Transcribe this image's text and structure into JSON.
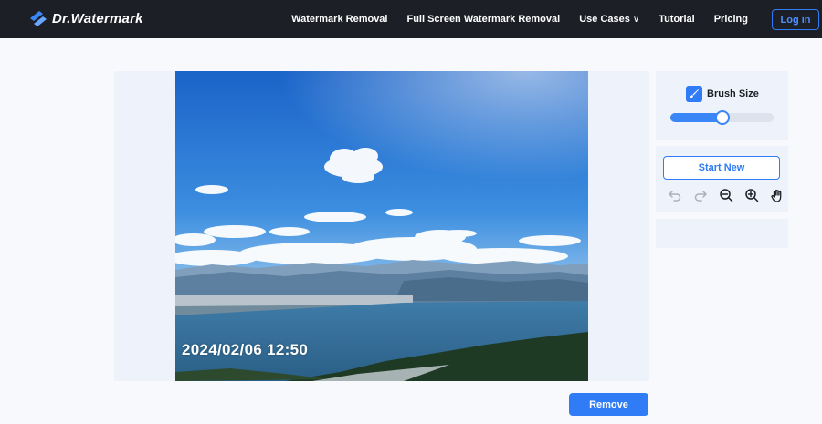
{
  "nav": {
    "brand": "Dr.Watermark",
    "links": [
      "Watermark Removal",
      "Full Screen Watermark Removal",
      "Use Cases",
      "Tutorial",
      "Pricing"
    ],
    "use_cases_caret": "∨",
    "login_label": "Log in"
  },
  "canvas": {
    "timestamp": "2024/02/06 12:50"
  },
  "brush": {
    "label": "Brush Size",
    "size_fraction": 0.5,
    "icon": "brush-icon"
  },
  "actions": {
    "start_new_label": "Start New",
    "tools": [
      "undo-icon",
      "redo-icon",
      "zoom-out-icon",
      "zoom-in-icon",
      "hand-icon"
    ]
  },
  "remove_label": "Remove",
  "colors": {
    "accent": "#2f7cf6",
    "nav_bg": "#1c1f26",
    "panel_bg": "#eef3fb"
  }
}
